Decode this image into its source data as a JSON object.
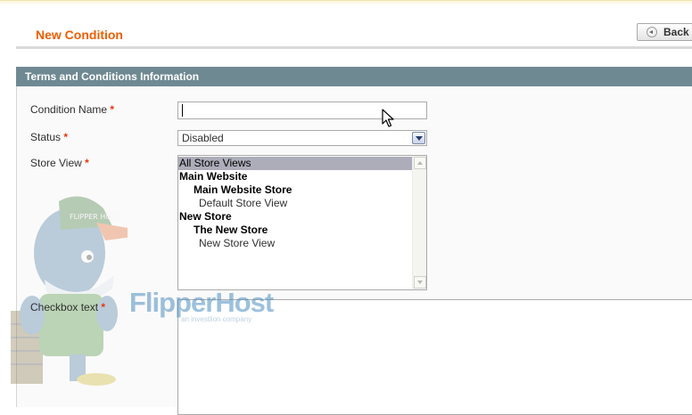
{
  "header": {
    "title": "New Condition",
    "back_label": "Back"
  },
  "fieldset": {
    "title": "Terms and Conditions Information",
    "fields": {
      "condition_name": {
        "label": "Condition Name",
        "required": "*",
        "value": ""
      },
      "status": {
        "label": "Status",
        "required": "*",
        "value": "Disabled"
      },
      "store_view": {
        "label": "Store View",
        "required": "*",
        "options": [
          {
            "text": "All Store Views",
            "level": 0,
            "bold": false,
            "selected": true
          },
          {
            "text": "Main Website",
            "level": 0,
            "bold": true,
            "selected": false
          },
          {
            "text": "Main Website Store",
            "level": 1,
            "bold": true,
            "selected": false
          },
          {
            "text": "Default Store View",
            "level": 2,
            "bold": false,
            "selected": false
          },
          {
            "text": "New Store",
            "level": 0,
            "bold": true,
            "selected": false
          },
          {
            "text": "The New Store",
            "level": 1,
            "bold": true,
            "selected": false
          },
          {
            "text": "New Store View",
            "level": 2,
            "bold": false,
            "selected": false
          }
        ]
      },
      "checkbox_text": {
        "label": "Checkbox text",
        "required": "*",
        "value": ""
      }
    }
  },
  "watermark": {
    "brand": "FlipperHost",
    "tagline": "an investlion company",
    "cap_text": "FLIPPER HOST"
  },
  "colors": {
    "title": "#eb5e00",
    "section_header": "#6f8992",
    "required": "#eb340a",
    "selected_option": "#adadba"
  },
  "icons": {
    "back": "back-arrow-circle-icon",
    "dropdown": "chevron-down-icon",
    "cursor": "mouse-pointer-icon"
  }
}
